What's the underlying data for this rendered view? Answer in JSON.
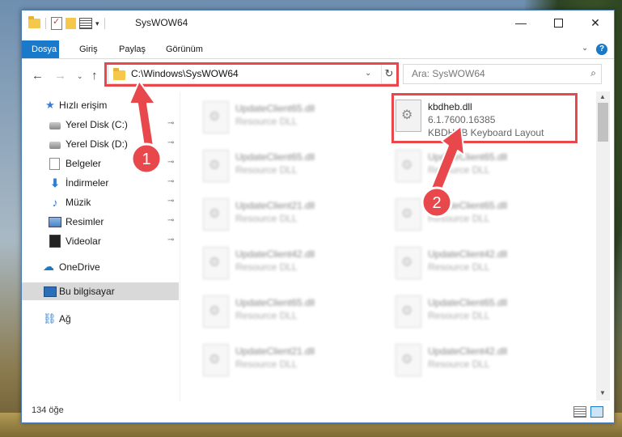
{
  "window": {
    "title": "SysWOW64",
    "controls": {
      "minimize": "—",
      "maximize": "",
      "close": "✕"
    }
  },
  "ribbon": {
    "tabs": [
      {
        "label": "Dosya"
      },
      {
        "label": "Giriş"
      },
      {
        "label": "Paylaş"
      },
      {
        "label": "Görünüm"
      }
    ],
    "expand_icon": "chevron-down-icon",
    "help_label": "?"
  },
  "address": {
    "path": "C:\\Windows\\SysWOW64",
    "dropdown_glyph": "⌄",
    "refresh_glyph": "↻"
  },
  "nav": {
    "back": "←",
    "forward": "→",
    "recent": "⌄",
    "up": "↑"
  },
  "search": {
    "placeholder": "Ara: SysWOW64",
    "icon_glyph": "⌕"
  },
  "sidebar": {
    "items": [
      {
        "label": "Hızlı erişim",
        "icon": "star-icon",
        "glyph": "★"
      },
      {
        "label": "Yerel Disk (C:)",
        "icon": "disk-icon",
        "pinned": true
      },
      {
        "label": "Yerel Disk (D:)",
        "icon": "disk-icon",
        "pinned": true
      },
      {
        "label": "Belgeler",
        "icon": "documents-icon",
        "pinned": true
      },
      {
        "label": "İndirmeler",
        "icon": "download-icon",
        "glyph": "⬇",
        "pinned": true
      },
      {
        "label": "Müzik",
        "icon": "music-icon",
        "glyph": "♪",
        "pinned": true
      },
      {
        "label": "Resimler",
        "icon": "pictures-icon",
        "pinned": true
      },
      {
        "label": "Videolar",
        "icon": "videos-icon",
        "pinned": true
      },
      {
        "label": "OneDrive",
        "icon": "cloud-icon",
        "glyph": "☁"
      },
      {
        "label": "Bu bilgisayar",
        "icon": "computer-icon",
        "selected": true
      },
      {
        "label": "Ağ",
        "icon": "network-icon",
        "glyph": "⛓"
      }
    ],
    "pin_glyph": "📌"
  },
  "files": {
    "highlighted": {
      "name": "kbdheb.dll",
      "version": "6.1.7600.16385",
      "description": "KBDHEB Keyboard Layout"
    },
    "blurred_left": [
      {
        "name": "UpdateClient65.dll",
        "desc": "Resource DLL"
      },
      {
        "name": "UpdateClient65.dll",
        "desc": "Resource DLL"
      },
      {
        "name": "UpdateClient21.dll",
        "desc": "Resource DLL"
      },
      {
        "name": "UpdateClient42.dll",
        "desc": "Resource DLL"
      },
      {
        "name": "UpdateClient65.dll",
        "desc": "Resource DLL"
      },
      {
        "name": "UpdateClient21.dll",
        "desc": "Resource DLL"
      }
    ],
    "blurred_right": [
      {
        "name": "UpdateClient65.dll",
        "desc": "Resource DLL"
      },
      {
        "name": "UpdateClient65.dll",
        "desc": "Resource DLL"
      },
      {
        "name": "UpdateClient42.dll",
        "desc": "Resource DLL"
      },
      {
        "name": "UpdateClient65.dll",
        "desc": "Resource DLL"
      },
      {
        "name": "UpdateClient42.dll",
        "desc": "Resource DLL"
      }
    ],
    "gear_glyph": "⚙"
  },
  "status": {
    "count": "134 öğe"
  },
  "annotations": {
    "step1": "1",
    "step2": "2",
    "color": "#e8474c"
  },
  "colors": {
    "accent": "#1979ca",
    "selected_bg": "#d9d9d9",
    "annotation": "#e8474c"
  }
}
